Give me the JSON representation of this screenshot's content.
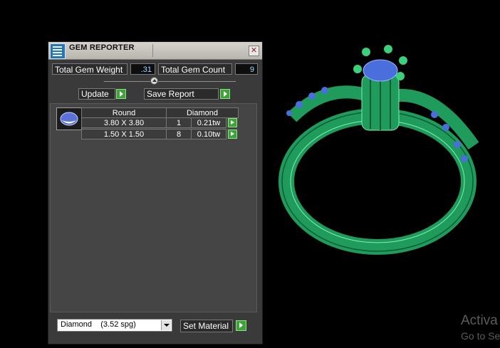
{
  "window": {
    "title": "GEM REPORTER",
    "close_symbol": "✕"
  },
  "summary": {
    "weight_label": "Total Gem Weight",
    "weight_value": ".31",
    "count_label": "Total Gem Count",
    "count_value": "9"
  },
  "actions": {
    "update_label": "Update",
    "save_label": "Save Report"
  },
  "gem_table": {
    "shape": "Round",
    "material": "Diamond",
    "thumbnail_icon": "round-gem-icon",
    "rows": [
      {
        "size": "3.80 X 3.80",
        "count": "1",
        "weight": "0.21tw"
      },
      {
        "size": "1.50 X 1.50",
        "count": "8",
        "weight": "0.10tw"
      }
    ]
  },
  "bottom": {
    "material_select": "Diamond    (3.52 spg)",
    "set_material_label": "Set Material"
  },
  "watermark": {
    "line1": "Activa",
    "line2": "Go to Se"
  },
  "colors": {
    "panel_bg": "#3a3a3a",
    "value_text": "#9fd8ff",
    "accent_green": "#3fa33a",
    "ring_green": "#1f9b5c",
    "gem_blue": "#4a6fdc"
  }
}
